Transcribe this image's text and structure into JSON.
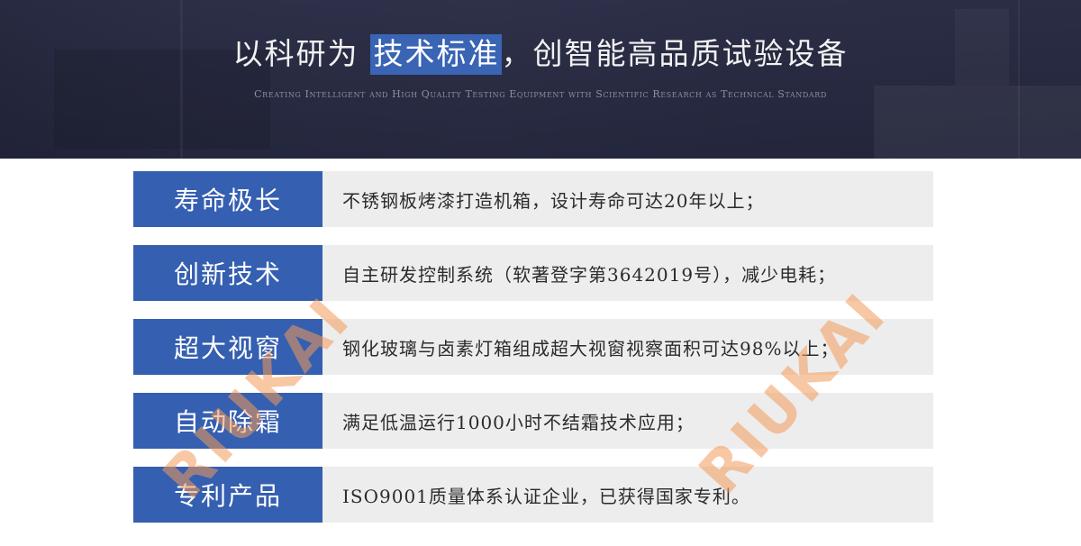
{
  "banner": {
    "headline_prefix": "以科研为",
    "headline_highlight": "技术标准",
    "headline_suffix": "，创智能高品质试验设备",
    "subtitle": "Creating Intelligent and High Quality Testing Equipment with Scientific Research as Technical Standard",
    "highlight_color": "#3a64b4"
  },
  "features": [
    {
      "label": "寿命极长",
      "description": "不锈钢板烤漆打造机箱，设计寿命可达20年以上；"
    },
    {
      "label": "创新技术",
      "description": "自主研发控制系统（软著登字第3642019号），减少电耗；"
    },
    {
      "label": "超大视窗",
      "description": "钢化玻璃与卤素灯箱组成超大视窗视察面积可达98%以上；"
    },
    {
      "label": "自动除霜",
      "description": "满足低温运行1000小时不结霜技术应用；"
    },
    {
      "label": "专利产品",
      "description": "ISO9001质量体系认证企业，已获得国家专利。"
    }
  ],
  "watermark": {
    "text": "RIUKAI",
    "color": "#f39a5a"
  },
  "colors": {
    "label_bg": "#355fb0",
    "desc_bg": "#ededed",
    "banner_bg": "#2c2f47"
  }
}
